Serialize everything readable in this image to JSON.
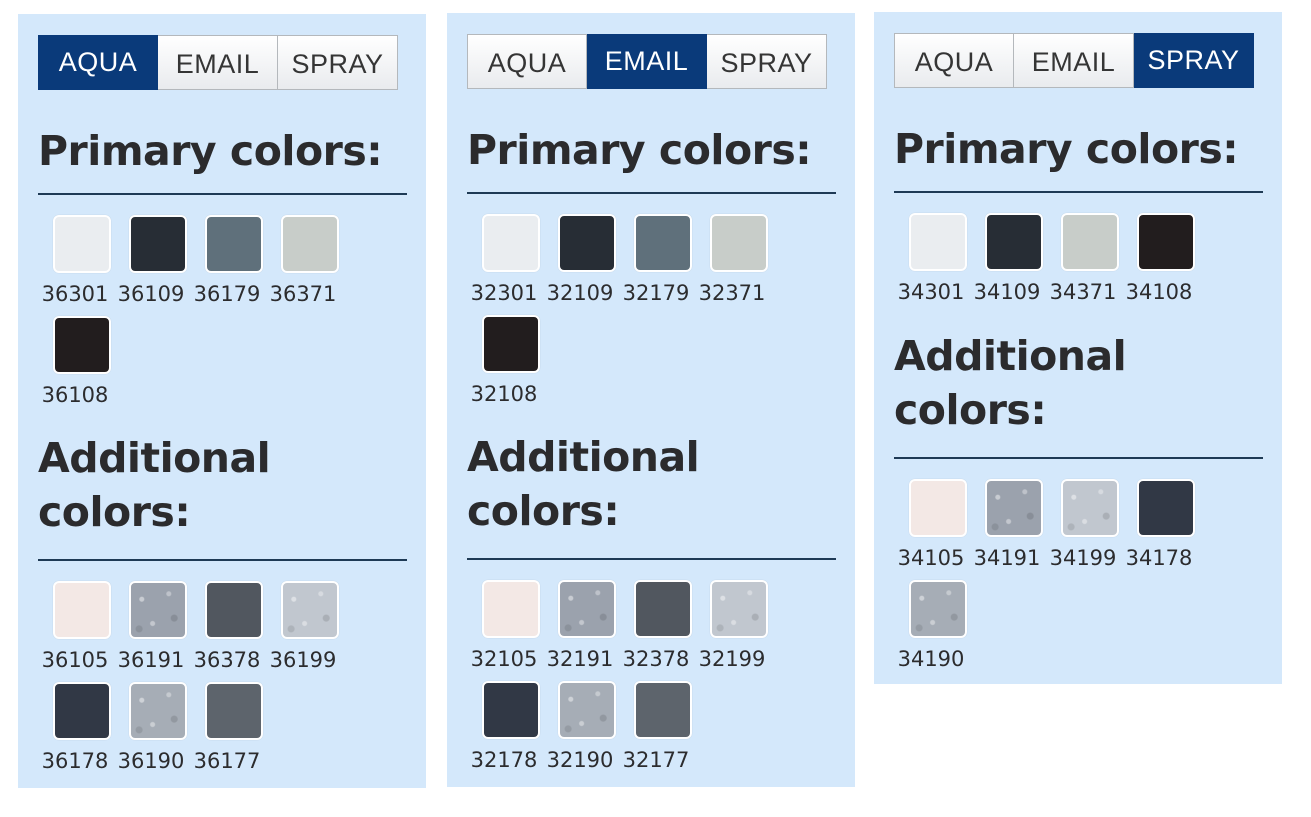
{
  "panels": [
    {
      "tabs": [
        {
          "label": "AQUA",
          "active": true
        },
        {
          "label": "EMAIL",
          "active": false
        },
        {
          "label": "SPRAY",
          "active": false
        }
      ],
      "primary_heading": "Primary colors:",
      "primary": [
        {
          "code": "36301",
          "color": "#eaedf0"
        },
        {
          "code": "36109",
          "color": "#272d35"
        },
        {
          "code": "36179",
          "color": "#5f707b"
        },
        {
          "code": "36371",
          "color": "#c8cdc9"
        },
        {
          "code": "36108",
          "color": "#221d1e"
        }
      ],
      "additional_heading": "Additional colors:",
      "additional": [
        {
          "code": "36105",
          "color": "#f3e8e5"
        },
        {
          "code": "36191",
          "color": "#9ba2ad",
          "glitter": true
        },
        {
          "code": "36378",
          "color": "#51575f"
        },
        {
          "code": "36199",
          "color": "#c1c7cf",
          "glitter": true
        },
        {
          "code": "36178",
          "color": "#313845"
        },
        {
          "code": "36190",
          "color": "#a6adb6",
          "glitter": true
        },
        {
          "code": "36177",
          "color": "#5d646c"
        }
      ]
    },
    {
      "tabs": [
        {
          "label": "AQUA",
          "active": false
        },
        {
          "label": "EMAIL",
          "active": true
        },
        {
          "label": "SPRAY",
          "active": false
        }
      ],
      "primary_heading": "Primary colors:",
      "primary": [
        {
          "code": "32301",
          "color": "#eaedf0"
        },
        {
          "code": "32109",
          "color": "#272d35"
        },
        {
          "code": "32179",
          "color": "#5f707b"
        },
        {
          "code": "32371",
          "color": "#c8cdc9"
        },
        {
          "code": "32108",
          "color": "#221d1e"
        }
      ],
      "additional_heading": "Additional colors:",
      "additional": [
        {
          "code": "32105",
          "color": "#f3e8e5"
        },
        {
          "code": "32191",
          "color": "#9ba2ad",
          "glitter": true
        },
        {
          "code": "32378",
          "color": "#51575f"
        },
        {
          "code": "32199",
          "color": "#c1c7cf",
          "glitter": true
        },
        {
          "code": "32178",
          "color": "#313845"
        },
        {
          "code": "32190",
          "color": "#a6adb6",
          "glitter": true
        },
        {
          "code": "32177",
          "color": "#5d646c"
        }
      ]
    },
    {
      "tabs": [
        {
          "label": "AQUA",
          "active": false
        },
        {
          "label": "EMAIL",
          "active": false
        },
        {
          "label": "SPRAY",
          "active": true
        }
      ],
      "primary_heading": "Primary colors:",
      "primary": [
        {
          "code": "34301",
          "color": "#eaedf0"
        },
        {
          "code": "34109",
          "color": "#272d35"
        },
        {
          "code": "34371",
          "color": "#c8cdc9"
        },
        {
          "code": "34108",
          "color": "#221d1e"
        }
      ],
      "additional_heading": "Additional colors:",
      "additional": [
        {
          "code": "34105",
          "color": "#f3e8e5"
        },
        {
          "code": "34191",
          "color": "#9ba2ad",
          "glitter": true
        },
        {
          "code": "34199",
          "color": "#c1c7cf",
          "glitter": true
        },
        {
          "code": "34178",
          "color": "#313845"
        },
        {
          "code": "34190",
          "color": "#a6adb6",
          "glitter": true
        }
      ]
    }
  ]
}
